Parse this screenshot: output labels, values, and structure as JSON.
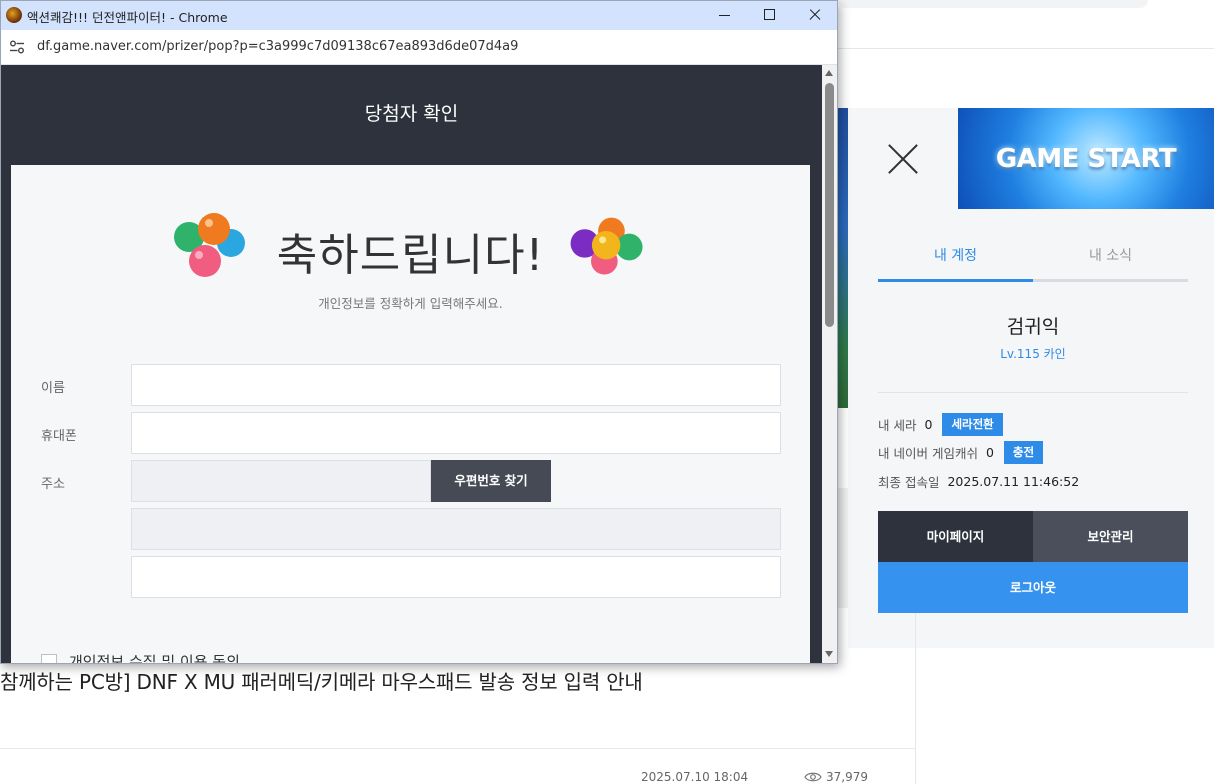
{
  "window": {
    "title": "액션쾌감!!! 던전앤파이터! - Chrome",
    "url": "df.game.naver.com/prizer/pop?p=c3a999c7d09138c67ea893d6de07d4a9"
  },
  "popup": {
    "header": "당첨자 확인",
    "congrats": "축하드립니다!",
    "subtitle": "개인정보를 정확하게 입력해주세요.",
    "fields": {
      "name_label": "이름",
      "name_value": "",
      "phone_label": "휴대폰",
      "phone_value": "",
      "address_label": "주소",
      "zip_button": "우편번호 찾기",
      "detail_value": ""
    },
    "agree_label": "개인정보 수집 및 이용 동의"
  },
  "side_panel": {
    "game_start": "GAME START",
    "tabs": [
      "내 계정",
      "내 소식"
    ],
    "user_name": "검귀익",
    "user_level": "Lv.115 카인",
    "sera_label": "내 세라",
    "sera_value": "0",
    "sera_button": "세라전환",
    "cash_label": "내 네이버 게임캐쉬",
    "cash_value": "0",
    "cash_button": "충전",
    "last_login_label": "최종 접속일",
    "last_login_value": "2025.07.11 11:46:52",
    "buttons": {
      "mypage": "마이페이지",
      "security": "보안관리",
      "logout": "로그아웃"
    }
  },
  "background": {
    "news_title": "참께하는 PC방] DNF X MU 패러메딕/키메라 마우스패드 발송 정보 입력 안내",
    "news_date": "2025.07.10 18:04",
    "news_views": "37,979"
  },
  "colors": {
    "accent": "#2f8be8",
    "dark": "#2e323c",
    "titlebar": "#d3e3fd"
  },
  "icons": [
    "game-favicon",
    "minimize-icon",
    "maximize-icon",
    "close-icon",
    "tune-icon",
    "balloons-icon",
    "eye-icon",
    "checkbox-icon"
  ]
}
